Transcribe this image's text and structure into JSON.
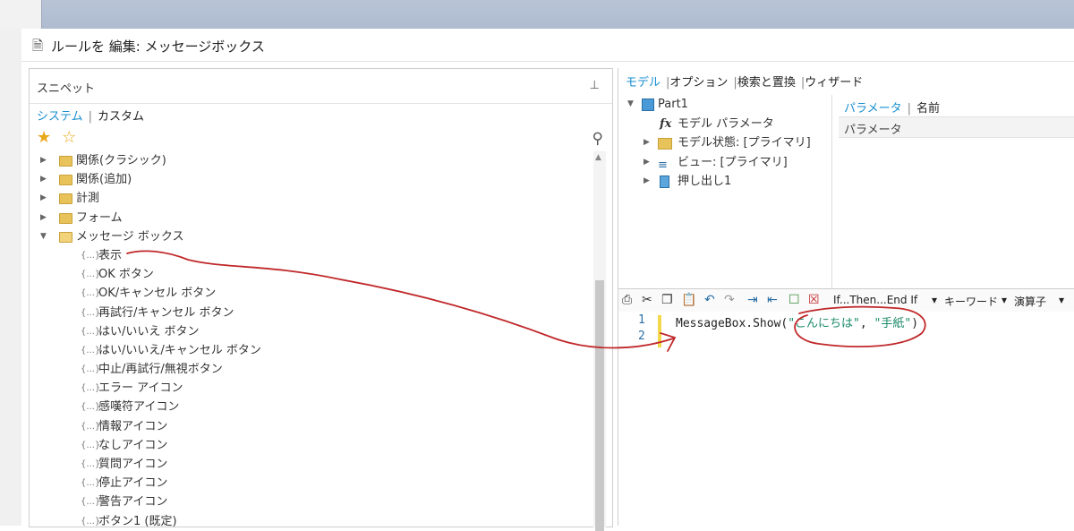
{
  "window": {
    "title": "ルールを 編集: メッセージボックス"
  },
  "snippets": {
    "title": "スニペット",
    "tabs": [
      "システム",
      "カスタム"
    ],
    "folders": [
      {
        "label": "関係(クラシック)",
        "expanded": false
      },
      {
        "label": "関係(追加)",
        "expanded": false
      },
      {
        "label": "計測",
        "expanded": false
      },
      {
        "label": "フォーム",
        "expanded": false
      },
      {
        "label": "メッセージ ボックス",
        "expanded": true
      }
    ],
    "items": [
      "表示",
      "OK ボタン",
      "OK/キャンセル ボタン",
      "再試行/キャンセル ボタン",
      "はい/いいえ ボタン",
      "はい/いいえ/キャンセル ボタン",
      "中止/再試行/無視ボタン",
      "エラー アイコン",
      "感嘆符アイコン",
      "情報アイコン",
      "なしアイコン",
      "質問アイコン",
      "停止アイコン",
      "警告アイコン",
      "ボタン1 (既定)"
    ],
    "snippet_icon": "{...}"
  },
  "right": {
    "tabs": [
      "モデル",
      "オプション",
      "検索と置換",
      "ウィザード"
    ],
    "model_tree": [
      {
        "label": "Part1",
        "icon": "part-cube-icon"
      },
      {
        "label": "モデル パラメータ",
        "icon": "fx-icon"
      },
      {
        "label": "モデル状態: [プライマリ]",
        "icon": "folder-icon"
      },
      {
        "label": "ビュー: [プライマリ]",
        "icon": "view-icon"
      },
      {
        "label": "押し出し1",
        "icon": "extrude-icon"
      }
    ],
    "param_tabs": [
      "パラメータ",
      "名前"
    ],
    "param_header": "パラメータ",
    "toolbar": {
      "ifthen": "If...Then...End If",
      "keyword": "キーワード",
      "operator": "演算子"
    },
    "editor": {
      "line_numbers": [
        "1",
        "2"
      ],
      "code_prefix": "MessageBox.Show(",
      "str1": "\"こんにちは\"",
      "sep": ", ",
      "str2": "\"手紙\"",
      "code_suffix": ")"
    }
  },
  "colors": {
    "accent": "#1a8fd0",
    "annotation": "#c0282a",
    "string": "#1d8b6a"
  }
}
